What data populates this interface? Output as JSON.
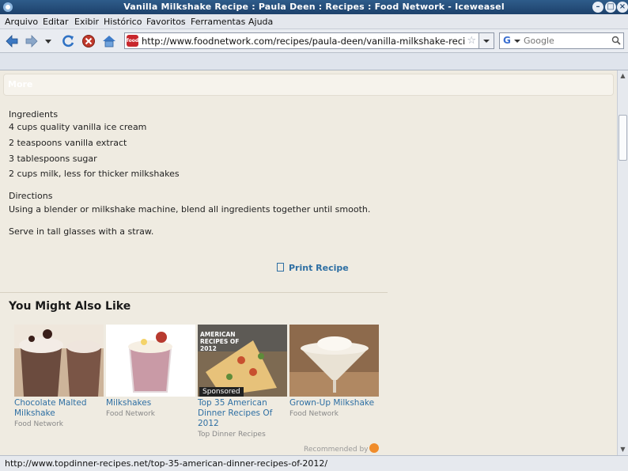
{
  "window": {
    "title": "Vanilla Milkshake Recipe : Paula Deen : Recipes : Food Network - Iceweasel"
  },
  "menubar": {
    "items": [
      "Arquivo",
      "Editar",
      "Exibir",
      "Histórico",
      "Favoritos",
      "Ferramentas",
      "Ajuda"
    ]
  },
  "navbar": {
    "url": "http://www.foodnetwork.com/recipes/paula-deen/vanilla-milkshake-recipe/index.html",
    "favicon_text": "food",
    "search_placeholder": "Google",
    "search_engine_letter": "G"
  },
  "page": {
    "more_label": "More",
    "ingredients_heading": "Ingredients",
    "ingredients": [
      "4 cups quality vanilla ice cream",
      "2 teaspoons vanilla extract",
      "3 tablespoons sugar",
      "2 cups milk, less for thicker milkshakes"
    ],
    "directions_heading": "Directions",
    "directions": [
      "Using a blender or milkshake machine, blend all ingredients together until smooth.",
      "Serve in tall glasses with a straw."
    ],
    "print_label": "Print Recipe",
    "related_heading": "You Might Also Like",
    "related": [
      {
        "title": "Chocolate Malted Milkshake",
        "source": "Food Network",
        "image": "chocolate-milkshake"
      },
      {
        "title": "Milkshakes",
        "source": "Food Network",
        "image": "berry-milkshake"
      },
      {
        "title": "Top 35 American Dinner Recipes Of 2012",
        "source": "Top Dinner Recipes",
        "image": "pizza",
        "badge": "Sponsored",
        "overlay": "AMERICAN RECIPES OF 2012"
      },
      {
        "title": "Grown-Up Milkshake",
        "source": "Food Network",
        "image": "martini-milkshake"
      }
    ],
    "recommended_by": "Recommended by"
  },
  "statusbar": {
    "text": "http://www.topdinner-recipes.net/top-35-american-dinner-recipes-of-2012/"
  },
  "colors": {
    "link": "#2e6fa3",
    "page_bg": "#efebe1",
    "titlebar": "#234c78"
  }
}
